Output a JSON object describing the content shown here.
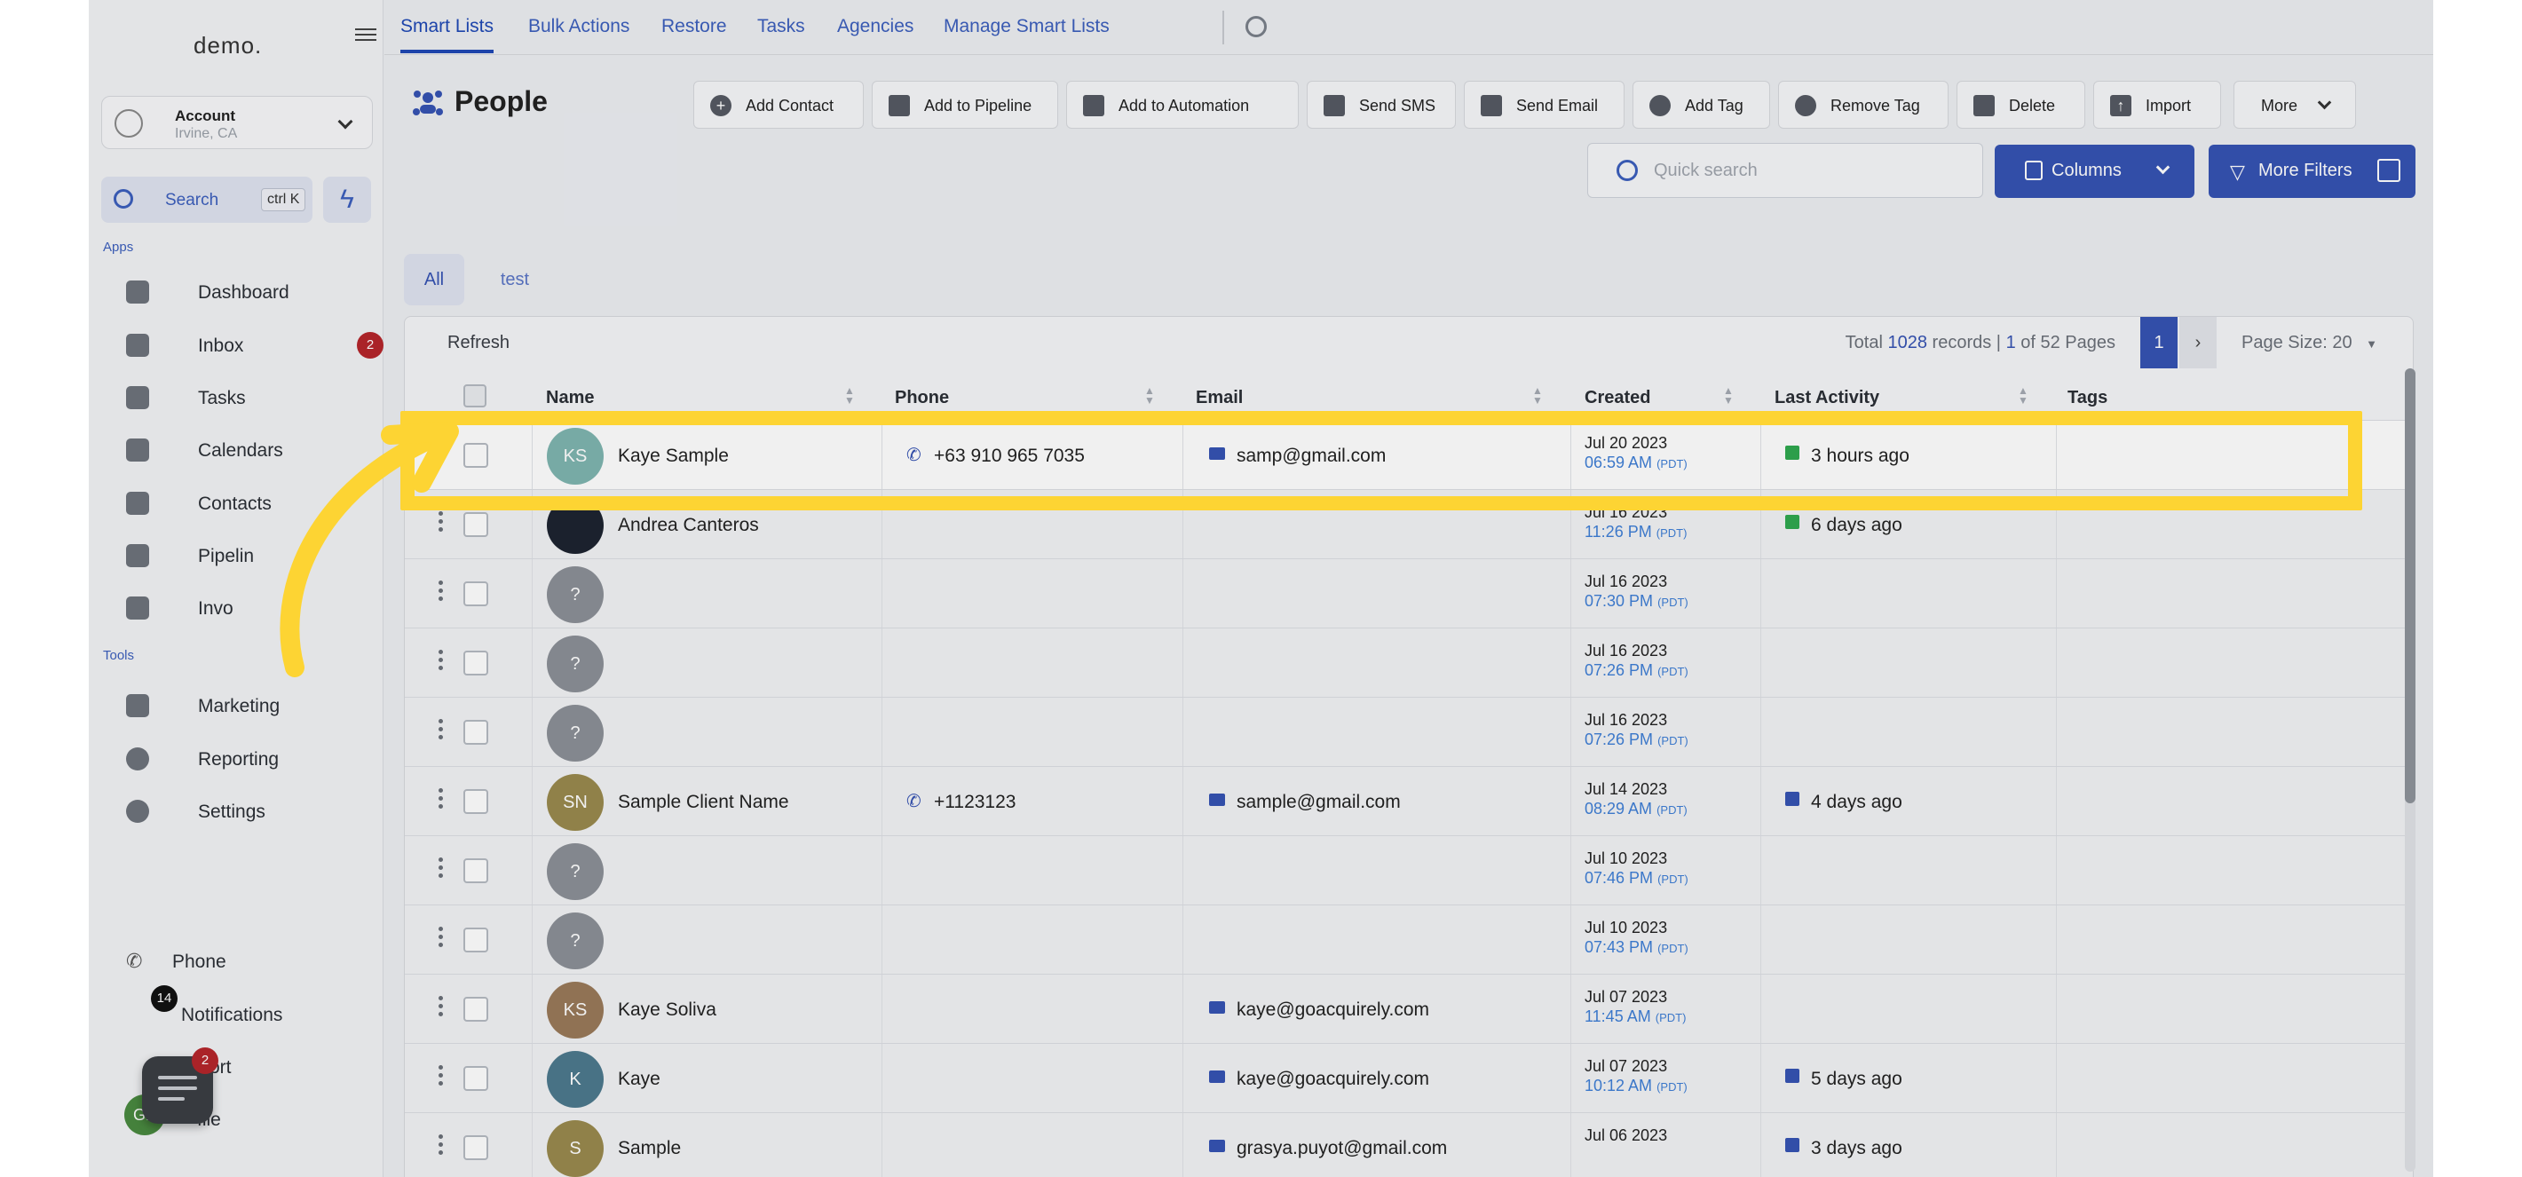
{
  "app": {
    "logo": "demo."
  },
  "account": {
    "name": "Account",
    "location": "Irvine, CA"
  },
  "search": {
    "label": "Search",
    "shortcut": "ctrl K"
  },
  "sidebar": {
    "apps_section": "Apps",
    "tools_section": "Tools",
    "apps": [
      {
        "label": "Dashboard",
        "icon": "dashboard-icon"
      },
      {
        "label": "Inbox",
        "icon": "inbox-icon",
        "badge": "2"
      },
      {
        "label": "Tasks",
        "icon": "tasks-icon"
      },
      {
        "label": "Calendars",
        "icon": "calendar-icon"
      },
      {
        "label": "Contacts",
        "icon": "contacts-icon"
      },
      {
        "label": "Pipelin",
        "icon": "pipeline-icon"
      },
      {
        "label": "Invo",
        "icon": "invoices-icon"
      }
    ],
    "tools": [
      {
        "label": "Marketing",
        "icon": "megaphone-icon"
      },
      {
        "label": "Reporting",
        "icon": "chart-icon"
      },
      {
        "label": "Settings",
        "icon": "gear-icon"
      }
    ],
    "bottom": [
      {
        "label": "Phone"
      },
      {
        "label": "Notifications",
        "badge": "14"
      },
      {
        "label": "ort",
        "badge": "2"
      },
      {
        "label": "file",
        "avatar": "GP"
      }
    ]
  },
  "topnav": {
    "tabs": [
      "Smart Lists",
      "Bulk Actions",
      "Restore",
      "Tasks",
      "Agencies",
      "Manage Smart Lists"
    ]
  },
  "header": {
    "title": "People",
    "actions": [
      "Add Contact",
      "Add to Pipeline",
      "Add to Automation",
      "Send SMS",
      "Send Email",
      "Add Tag",
      "Remove Tag",
      "Delete",
      "Import",
      "More"
    ],
    "quick_search_placeholder": "Quick search",
    "columns_label": "Columns",
    "more_filters_label": "More Filters"
  },
  "list_tabs": [
    "All",
    "test"
  ],
  "table": {
    "refresh": "Refresh",
    "total_prefix": "Total",
    "total_count": "1028",
    "total_mid": "records |",
    "page_current": "1",
    "page_of": "of 52 Pages",
    "page_btn": "1",
    "page_size": "Page Size: 20",
    "headers": [
      "Name",
      "Phone",
      "Email",
      "Created",
      "Last Activity",
      "Tags"
    ],
    "rows": [
      {
        "initials": "KS",
        "avatar_color": "#7fb5b0",
        "name": "Kaye Sample",
        "phone": "+63 910 965 7035",
        "email": "samp@gmail.com",
        "date": "Jul 20 2023",
        "time": "06:59 AM",
        "tz": "(PDT)",
        "activity": "3 hours ago",
        "activity_icon": "sms"
      },
      {
        "initials": "",
        "avatar_color": "#1d2430",
        "name": "Andrea Canteros",
        "phone": "",
        "email": "",
        "date": "Jul 16 2023",
        "time": "11:26 PM",
        "tz": "(PDT)",
        "activity": "6 days ago",
        "activity_icon": "sms"
      },
      {
        "initials": "?",
        "avatar_color": "#8c9097",
        "name": "",
        "phone": "",
        "email": "",
        "date": "Jul 16 2023",
        "time": "07:30 PM",
        "tz": "(PDT)",
        "activity": "",
        "activity_icon": ""
      },
      {
        "initials": "?",
        "avatar_color": "#8c9097",
        "name": "",
        "phone": "",
        "email": "",
        "date": "Jul 16 2023",
        "time": "07:26 PM",
        "tz": "(PDT)",
        "activity": "",
        "activity_icon": ""
      },
      {
        "initials": "?",
        "avatar_color": "#8c9097",
        "name": "",
        "phone": "",
        "email": "",
        "date": "Jul 16 2023",
        "time": "07:26 PM",
        "tz": "(PDT)",
        "activity": "",
        "activity_icon": ""
      },
      {
        "initials": "SN",
        "avatar_color": "#9a8a4e",
        "name": "Sample Client Name",
        "phone": "+1123123",
        "email": "sample@gmail.com",
        "date": "Jul 14 2023",
        "time": "08:29 AM",
        "tz": "(PDT)",
        "activity": "4 days ago",
        "activity_icon": "email"
      },
      {
        "initials": "?",
        "avatar_color": "#8c9097",
        "name": "",
        "phone": "",
        "email": "",
        "date": "Jul 10 2023",
        "time": "07:46 PM",
        "tz": "(PDT)",
        "activity": "",
        "activity_icon": ""
      },
      {
        "initials": "?",
        "avatar_color": "#8c9097",
        "name": "",
        "phone": "",
        "email": "",
        "date": "Jul 10 2023",
        "time": "07:43 PM",
        "tz": "(PDT)",
        "activity": "",
        "activity_icon": ""
      },
      {
        "initials": "KS",
        "avatar_color": "#9a7a5a",
        "name": "Kaye Soliva",
        "phone": "",
        "email": "kaye@goacquirely.com",
        "date": "Jul 07 2023",
        "time": "11:45 AM",
        "tz": "(PDT)",
        "activity": "",
        "activity_icon": ""
      },
      {
        "initials": "K",
        "avatar_color": "#4d7a8e",
        "name": "Kaye",
        "phone": "",
        "email": "kaye@goacquirely.com",
        "date": "Jul 07 2023",
        "time": "10:12 AM",
        "tz": "(PDT)",
        "activity": "5 days ago",
        "activity_icon": "email"
      },
      {
        "initials": "S",
        "avatar_color": "#9a8a4e",
        "name": "Sample",
        "phone": "",
        "email": "grasya.puyot@gmail.com",
        "date": "Jul 06 2023",
        "time": "",
        "tz": "",
        "activity": "3 days ago",
        "activity_icon": "email"
      }
    ]
  },
  "colors": {
    "accent": "#3653b3",
    "highlight": "#fdd433",
    "arrow": "#fdd433"
  }
}
